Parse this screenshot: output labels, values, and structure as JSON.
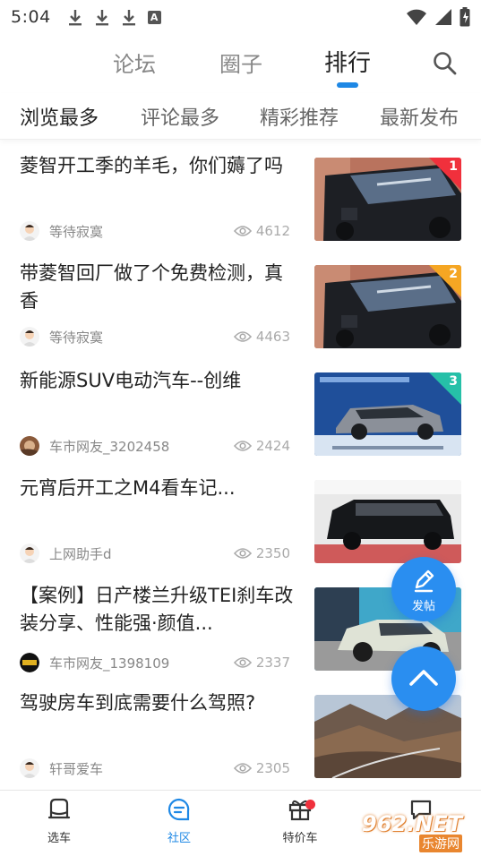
{
  "status_bar": {
    "time": "5:04",
    "a_label": "A"
  },
  "top_nav": {
    "tabs": [
      {
        "label": "论坛"
      },
      {
        "label": "圈子"
      },
      {
        "label": "排行"
      }
    ],
    "active_tab": "排行",
    "accent_color": "#1e88e5"
  },
  "sub_tabs": [
    {
      "label": "浏览最多"
    },
    {
      "label": "评论最多"
    },
    {
      "label": "精彩推荐"
    },
    {
      "label": "最新发布"
    }
  ],
  "posts": [
    {
      "title": "菱智开工季的羊毛，你们薅了吗",
      "author": "等待寂寞",
      "views": "4612",
      "rank": "1",
      "rank_color": "#f0303c",
      "thumb": "van-garage"
    },
    {
      "title": "带菱智回厂做了个免费检测，真香",
      "author": "等待寂寞",
      "views": "4463",
      "rank": "2",
      "rank_color": "#f5a623",
      "thumb": "van-garage"
    },
    {
      "title": "新能源SUV电动汽车--创维",
      "author": "车市网友_3202458",
      "views": "2424",
      "rank": "3",
      "rank_color": "#26c0a8",
      "thumb": "suv-poster"
    },
    {
      "title": "元宵后开工之M4看车记...",
      "author": "上网助手d",
      "views": "2350",
      "rank": "",
      "thumb": "black-mpv"
    },
    {
      "title": "【案例】日产楼兰升级TEI刹车改装分享、性能强·颜值...",
      "author": "车市网友_1398109",
      "views": "2337",
      "rank": "",
      "thumb": "white-suv"
    },
    {
      "title": "驾驶房车到底需要什么驾照?",
      "author": "轩哥爱车",
      "views": "2305",
      "rank": "",
      "thumb": "landscape"
    }
  ],
  "fab": {
    "post_label": "发帖"
  },
  "bottom_nav": [
    {
      "label": "选车",
      "icon": "car-icon"
    },
    {
      "label": "社区",
      "icon": "chat-icon"
    },
    {
      "label": "特价车",
      "icon": "gift-icon"
    },
    {
      "label": "",
      "icon": "message-icon"
    }
  ],
  "watermark": {
    "main": "962.NET",
    "sub": "乐游网"
  }
}
